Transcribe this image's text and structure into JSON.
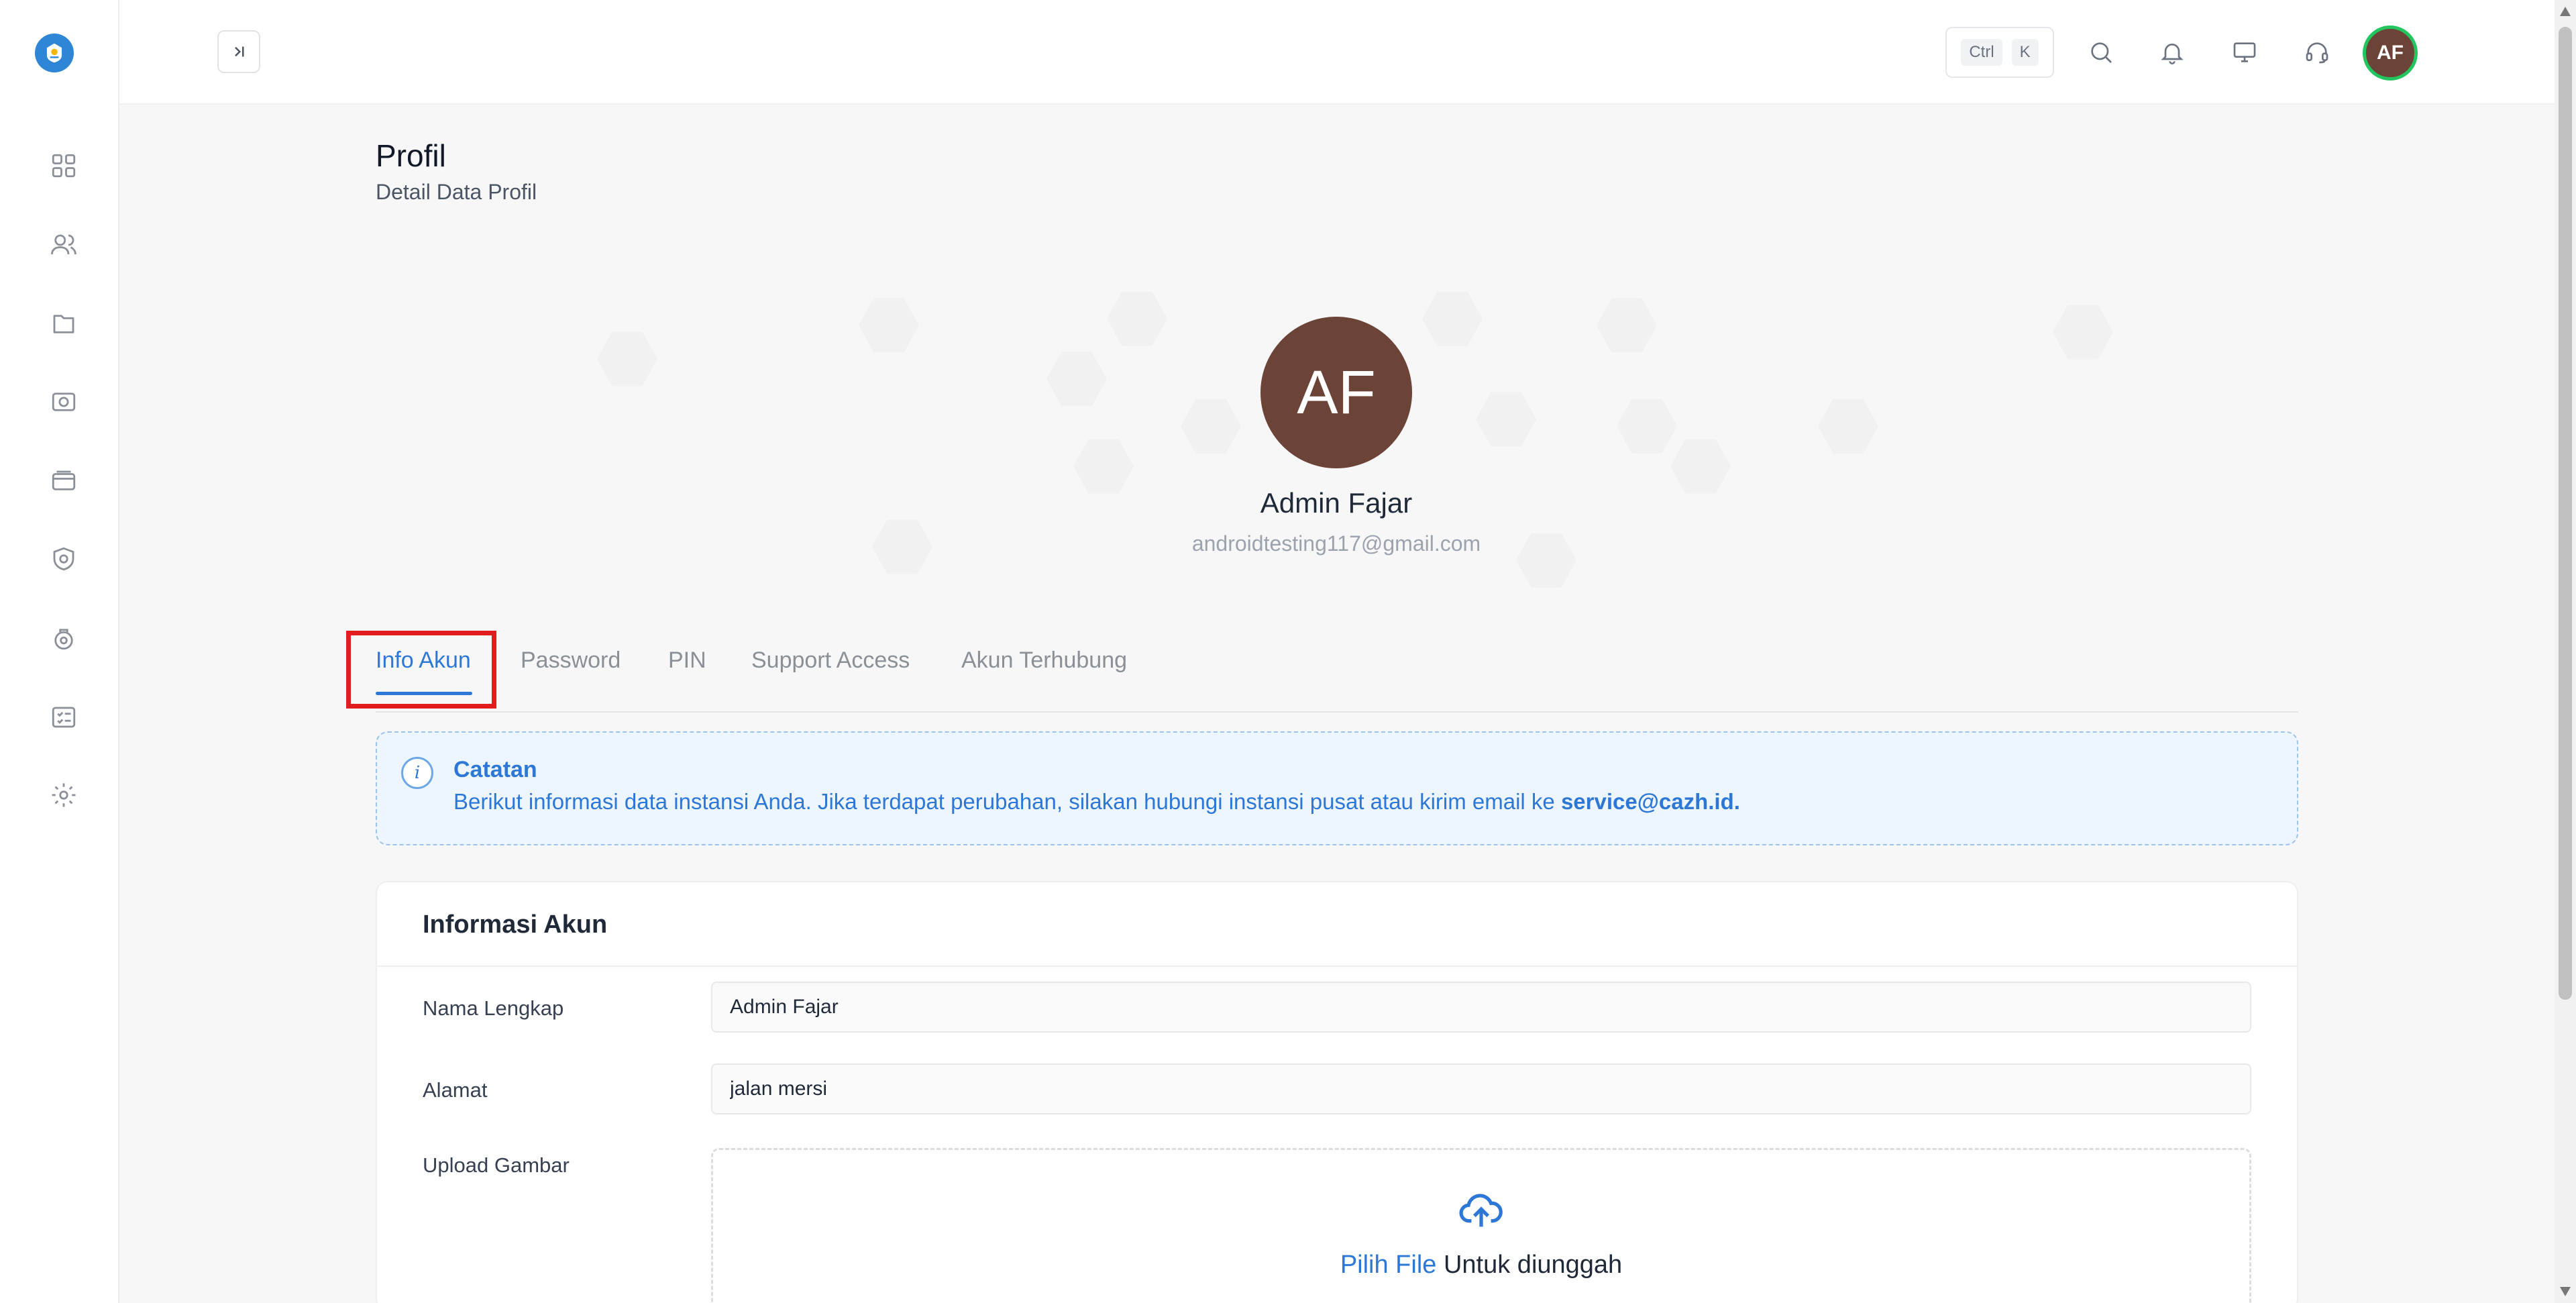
{
  "topbar": {
    "kbd_ctrl": "Ctrl",
    "kbd_k": "K",
    "avatar_initials": "AF"
  },
  "sidebar": {
    "icons": [
      "dashboard-icon",
      "users-icon",
      "folder-icon",
      "camera-icon",
      "card-icon",
      "shield-icon",
      "lock-icon",
      "checklist-icon",
      "settings-icon"
    ]
  },
  "page": {
    "title": "Profil",
    "subtitle": "Detail Data Profil"
  },
  "profile": {
    "initials": "AF",
    "name": "Admin Fajar",
    "email": "androidtesting117@gmail.com"
  },
  "tabs": [
    {
      "label": "Info Akun",
      "active": true
    },
    {
      "label": "Password",
      "active": false
    },
    {
      "label": "PIN",
      "active": false
    },
    {
      "label": "Support Access",
      "active": false
    },
    {
      "label": "Akun Terhubung",
      "active": false
    }
  ],
  "note": {
    "title": "Catatan",
    "text": "Berikut informasi data instansi Anda. Jika terdapat perubahan, silakan hubungi instansi pusat atau kirim email ke ",
    "email": "service@cazh.id."
  },
  "account_card": {
    "title": "Informasi Akun",
    "fields": [
      {
        "label": "Nama Lengkap",
        "value": "Admin Fajar"
      },
      {
        "label": "Alamat",
        "value": "jalan mersi"
      }
    ],
    "upload_label": "Upload Gambar",
    "upload_link": "Pilih File",
    "upload_text": " Untuk diunggah"
  },
  "colors": {
    "accent": "#2d78d6",
    "avatar_bg": "#6b4437",
    "highlight": "#e11d1d"
  }
}
